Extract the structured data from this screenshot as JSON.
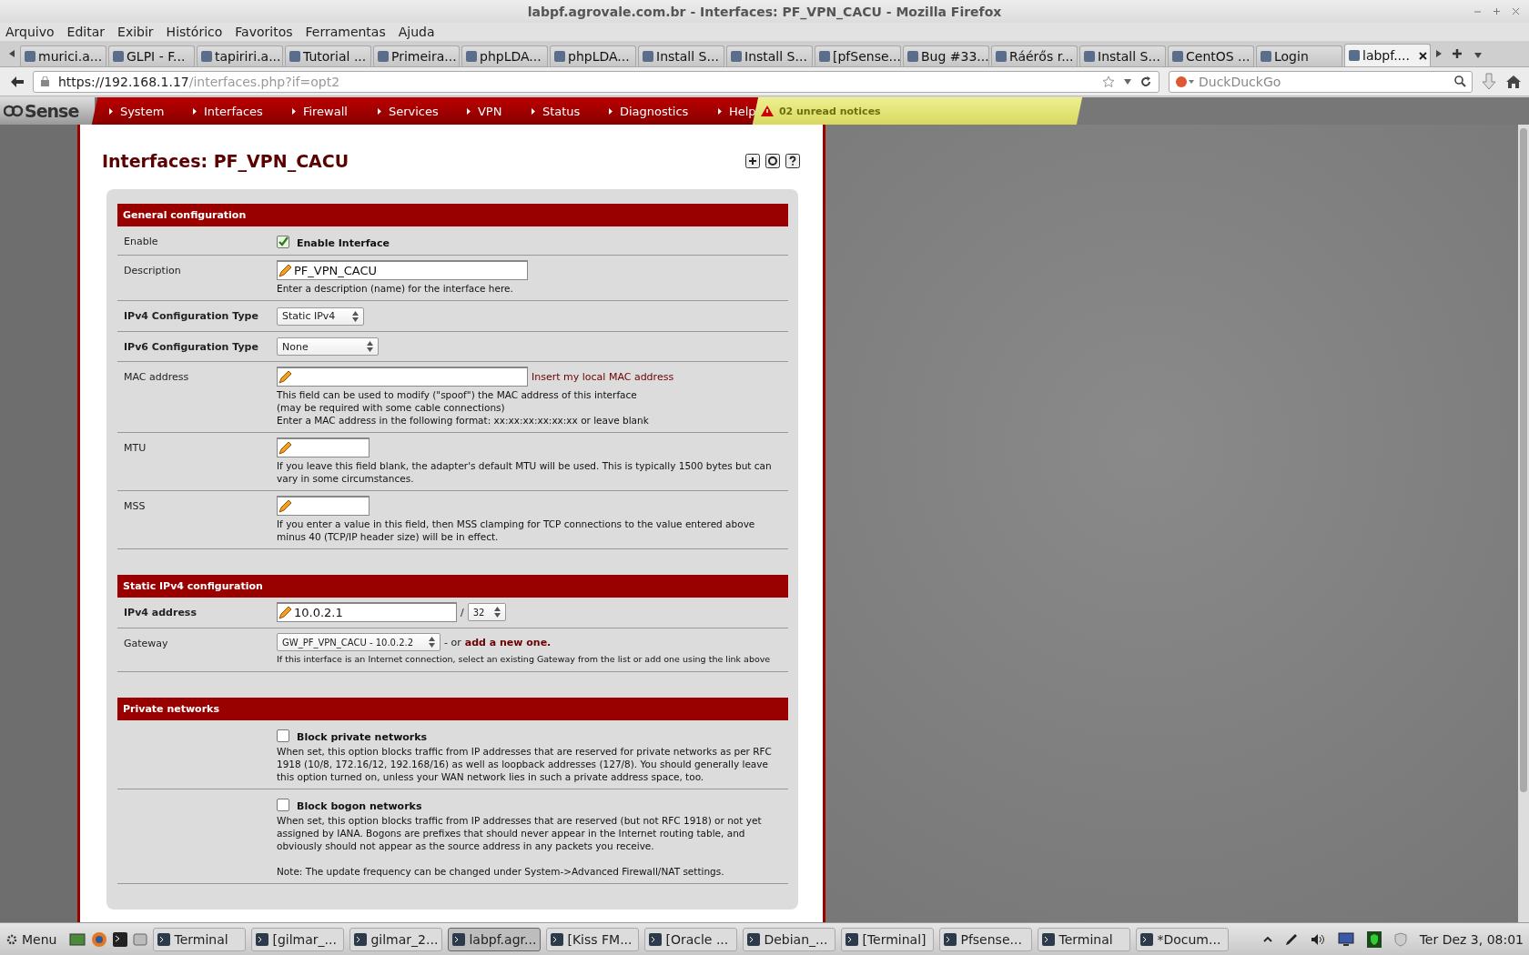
{
  "window": {
    "title": "labpf.agrovale.com.br - Interfaces: PF_VPN_CACU - Mozilla Firefox"
  },
  "menu": [
    "Arquivo",
    "Editar",
    "Exibir",
    "Histórico",
    "Favoritos",
    "Ferramentas",
    "Ajuda"
  ],
  "tabs": [
    {
      "label": "murici.a...",
      "selected": false
    },
    {
      "label": "GLPI - F...",
      "selected": false
    },
    {
      "label": "tapiriri.a...",
      "selected": false
    },
    {
      "label": "Tutorial ...",
      "selected": false
    },
    {
      "label": "Primeira...",
      "selected": false
    },
    {
      "label": "phpLDA...",
      "selected": false
    },
    {
      "label": "phpLDA...",
      "selected": false
    },
    {
      "label": "Install S...",
      "selected": false
    },
    {
      "label": "Install S...",
      "selected": false
    },
    {
      "label": "[pfSense...",
      "selected": false
    },
    {
      "label": "Bug #33...",
      "selected": false
    },
    {
      "label": "Ráérős r...",
      "selected": false
    },
    {
      "label": "Install S...",
      "selected": false
    },
    {
      "label": "CentOS ...",
      "selected": false
    },
    {
      "label": "Login",
      "selected": false
    },
    {
      "label": "labpf....",
      "selected": true
    }
  ],
  "address": {
    "host": "https://192.168.1.17",
    "path": "/interfaces.php?if=opt2"
  },
  "search": {
    "placeholder": "DuckDuckGo"
  },
  "nav": {
    "logo": "Sense",
    "items": [
      "System",
      "Interfaces",
      "Firewall",
      "Services",
      "VPN",
      "Status",
      "Diagnostics",
      "Help"
    ],
    "notice": "02 unread notices"
  },
  "page": {
    "title": "Interfaces: PF_VPN_CACU",
    "sections": [
      {
        "title": "General configuration",
        "rows": [
          {
            "kind": "checkbox",
            "label": "Enable",
            "option": "Enable Interface",
            "checked": true
          },
          {
            "kind": "text",
            "label": "Description",
            "value": "PF_VPN_CACU",
            "hint": [
              "Enter a description (name) for the interface here."
            ]
          },
          {
            "kind": "select",
            "label": "IPv4 Configuration Type",
            "bold": true,
            "value": "Static IPv4"
          },
          {
            "kind": "select",
            "label": "IPv6 Configuration Type",
            "bold": true,
            "value": "None"
          },
          {
            "kind": "text",
            "label": "MAC address",
            "link": "Insert my local MAC address",
            "hint": [
              "This field can be used to modify (\"spoof\") the MAC address of this interface",
              "(may be required with some cable connections)",
              "Enter a MAC address in the following format: xx:xx:xx:xx:xx:xx or leave blank"
            ]
          },
          {
            "kind": "short",
            "label": "MTU",
            "hint": [
              "If you leave this field blank, the adapter's default MTU will be used. This is typically 1500 bytes but can vary in some circumstances."
            ]
          },
          {
            "kind": "short",
            "label": "MSS",
            "hint": [
              "If you enter a value in this field, then MSS clamping for TCP connections to the value entered above minus 40 (TCP/IP header size) will be in effect."
            ]
          }
        ]
      },
      {
        "title": "Static IPv4 configuration",
        "rows": [
          {
            "kind": "address",
            "label": "IPv4 address",
            "bold": true,
            "value": "10.0.2.1",
            "separator": "/",
            "mask": "32"
          },
          {
            "kind": "gateway",
            "label": "Gateway",
            "value": "GW_PF_VPN_CACU - 10.0.2.2",
            "or": "- or",
            "link": "add a new one.",
            "hint": [
              "If this interface is an Internet connection, select an existing Gateway from the list or add one using the link above"
            ]
          }
        ]
      },
      {
        "title": "Private networks",
        "rows": [
          {
            "kind": "checkbox",
            "option": "Block private networks",
            "checked": false,
            "hint": [
              "When set, this option blocks traffic from IP addresses that are reserved for private networks as per RFC 1918 (10/8, 172.16/12, 192.168/16) as well as loopback addresses (127/8).   You should generally leave this option turned on, unless your WAN network lies in such a private address space, too."
            ]
          },
          {
            "kind": "checkbox",
            "option": "Block bogon networks",
            "checked": false,
            "hint": [
              "When set, this option blocks traffic from IP addresses that are reserved (but not RFC 1918) or not yet assigned by IANA.   Bogons are prefixes that should never appear in the Internet routing table, and obviously should not appear as the source address in any packets you receive.",
              "Note: The update frequency can be changed under System->Advanced Firewall/NAT settings."
            ]
          }
        ]
      }
    ]
  },
  "taskbar": {
    "menu": "Menu",
    "tasks": [
      {
        "label": "Terminal",
        "selected": false
      },
      {
        "label": "[gilmar_...",
        "selected": false
      },
      {
        "label": "gilmar_2...",
        "selected": false
      },
      {
        "label": "labpf.agr...",
        "selected": true
      },
      {
        "label": "[Kiss FM...",
        "selected": false
      },
      {
        "label": "[Oracle ...",
        "selected": false
      },
      {
        "label": "Debian_...",
        "selected": false
      },
      {
        "label": "[Terminal]",
        "selected": false
      },
      {
        "label": "Pfsense...",
        "selected": false
      },
      {
        "label": "Terminal",
        "selected": false
      },
      {
        "label": "*Docum...",
        "selected": false
      }
    ],
    "clock": "Ter Dez  3, 08:01"
  }
}
